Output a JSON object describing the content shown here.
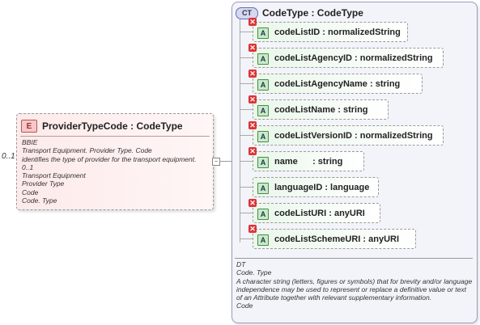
{
  "element": {
    "badge": "E",
    "title": "ProviderTypeCode : CodeType",
    "multiplicity": "0..1",
    "doc_lines": [
      "BBIE",
      "Transport Equipment. Provider Type. Code",
      "identifies the type of provider for the transport equipment.",
      "0..1",
      "Transport Equipment",
      "Provider Type",
      "Code",
      "Code. Type"
    ]
  },
  "collapse_symbol": "−",
  "complex_type": {
    "badge": "CT",
    "title": "CodeType : CodeType",
    "attribute_badge": "A",
    "prohibited_mark": "✕",
    "attributes": [
      "codeListID : normalizedString",
      "codeListAgencyID : normalizedString",
      "codeListAgencyName : string",
      "codeListName : string",
      "codeListVersionID : normalizedString",
      "name      : string",
      "languageID : language",
      "codeListURI : anyURI",
      "codeListSchemeURI : anyURI"
    ],
    "doc_lines": [
      "DT",
      "Code. Type",
      "A character string (letters, figures or symbols) that for brevity and/or language independence may be used to represent or replace a definitive value or text of an Attribute together with relevant supplementary information.",
      "Code"
    ]
  }
}
